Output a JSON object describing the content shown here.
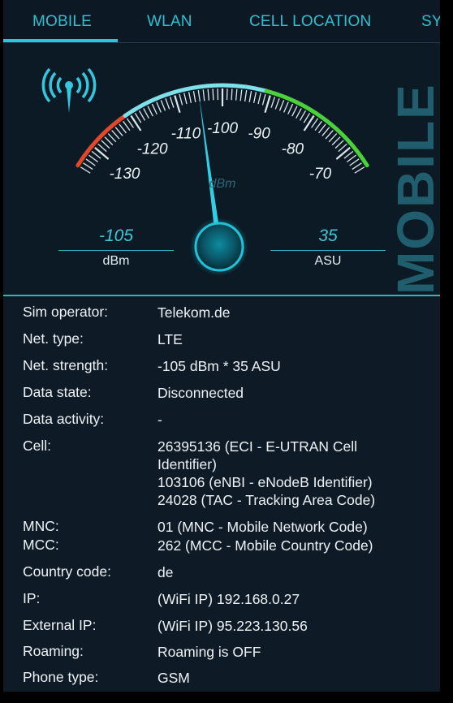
{
  "tabs": [
    {
      "label": "MOBILE",
      "active": true
    },
    {
      "label": "WLAN",
      "active": false
    },
    {
      "label": "CELL LOCATION",
      "active": false
    },
    {
      "label": "SY",
      "active": false
    }
  ],
  "gauge": {
    "ticks": [
      "-130",
      "-120",
      "-110",
      "-100",
      "-90",
      "-80",
      "-70"
    ],
    "unit": "dBm",
    "reading": -105,
    "side_title": "MOBILE"
  },
  "readouts": {
    "dbm": {
      "value": "-105",
      "unit": "dBm"
    },
    "asu": {
      "value": "35",
      "unit": "ASU"
    }
  },
  "info": [
    {
      "label": "Sim operator:",
      "lines": [
        "Telekom.de"
      ]
    },
    {
      "label": "Net. type:",
      "lines": [
        "LTE"
      ]
    },
    {
      "label": "Net. strength:",
      "lines": [
        "-105 dBm * 35 ASU"
      ]
    },
    {
      "label": "Data state:",
      "lines": [
        "Disconnected"
      ]
    },
    {
      "label": "Data activity:",
      "lines": [
        "-"
      ]
    },
    {
      "label": "Cell:",
      "lines": [
        "26395136 (ECI - E-UTRAN Cell",
        "Identifier)",
        "103106 (eNBI - eNodeB Identifier)",
        "24028 (TAC - Tracking Area Code)"
      ]
    },
    {
      "label": "MNC:",
      "lines": [
        "01 (MNC - Mobile Network Code)"
      ]
    },
    {
      "label": "MCC:",
      "lines": [
        "262 (MCC - Mobile Country Code)"
      ]
    },
    {
      "label": "Country code:",
      "lines": [
        "de"
      ]
    },
    {
      "label": "IP:",
      "lines": [
        "(WiFi IP) 192.168.0.27"
      ]
    },
    {
      "label": "External IP:",
      "lines": [
        "(WiFi IP) 95.223.130.56"
      ]
    },
    {
      "label": "Roaming:",
      "lines": [
        "Roaming is OFF"
      ]
    },
    {
      "label": "Phone type:",
      "lines": [
        "GSM"
      ]
    }
  ],
  "colors": {
    "accent": "#2ec5d8",
    "red": "#e0482a",
    "green": "#4bd23a",
    "background": "#0c1823"
  }
}
